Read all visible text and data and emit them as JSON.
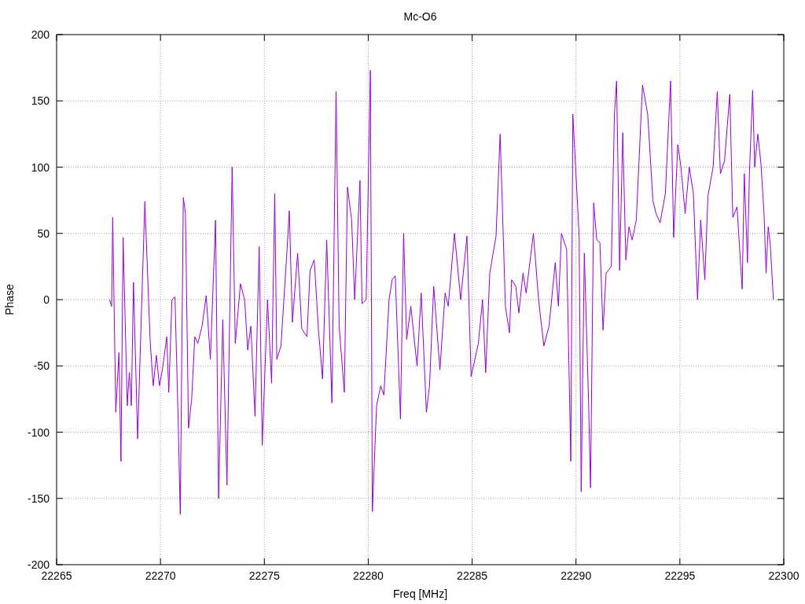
{
  "chart_data": {
    "type": "line",
    "grid": true,
    "title": "Mc-O6",
    "xlabel": "Freq [MHz]",
    "ylabel": "Phase",
    "xlim": [
      22265,
      22300
    ],
    "ylim": [
      -200,
      200
    ],
    "xticks": [
      22265,
      22270,
      22275,
      22280,
      22285,
      22290,
      22295,
      22300
    ],
    "yticks": [
      -200,
      -150,
      -100,
      -50,
      0,
      50,
      100,
      150,
      200
    ],
    "x": [
      22267.55,
      22267.65,
      22267.7,
      22267.85,
      22268.0,
      22268.1,
      22268.2,
      22268.4,
      22268.5,
      22268.6,
      22268.7,
      22268.9,
      22269.1,
      22269.25,
      22269.5,
      22269.65,
      22269.8,
      22269.95,
      22270.1,
      22270.3,
      22270.4,
      22270.55,
      22270.7,
      22270.85,
      22270.95,
      22271.1,
      22271.2,
      22271.35,
      22271.5,
      22271.65,
      22271.8,
      22272.0,
      22272.2,
      22272.4,
      22272.65,
      22272.8,
      22273.0,
      22273.2,
      22273.45,
      22273.6,
      22273.85,
      22274.05,
      22274.2,
      22274.35,
      22274.55,
      22274.75,
      22274.9,
      22275.15,
      22275.35,
      22275.5,
      22275.6,
      22275.8,
      22276.1,
      22276.2,
      22276.35,
      22276.6,
      22276.8,
      22277.05,
      22277.2,
      22277.4,
      22277.6,
      22277.8,
      22278.0,
      22278.25,
      22278.45,
      22278.6,
      22278.85,
      22279.0,
      22279.2,
      22279.35,
      22279.6,
      22279.7,
      22279.9,
      22280.1,
      22280.2,
      22280.4,
      22280.6,
      22280.75,
      22281.0,
      22281.15,
      22281.3,
      22281.55,
      22281.7,
      22281.85,
      22282.05,
      22282.35,
      22282.55,
      22282.8,
      22282.95,
      22283.15,
      22283.45,
      22283.7,
      22283.85,
      22284.15,
      22284.45,
      22284.75,
      22284.95,
      22285.3,
      22285.5,
      22285.65,
      22285.85,
      22286.15,
      22286.35,
      22286.6,
      22286.8,
      22286.9,
      22287.1,
      22287.25,
      22287.45,
      22287.6,
      22287.95,
      22288.2,
      22288.45,
      22288.7,
      22289.0,
      22289.15,
      22289.3,
      22289.55,
      22289.75,
      22289.85,
      22290.15,
      22290.25,
      22290.4,
      22290.6,
      22290.7,
      22290.85,
      22291.0,
      22291.15,
      22291.3,
      22291.45,
      22291.7,
      22291.85,
      22291.95,
      22292.1,
      22292.25,
      22292.4,
      22292.55,
      22292.7,
      22292.9,
      22293.2,
      22293.45,
      22293.7,
      22293.85,
      22294.05,
      22294.3,
      22294.55,
      22294.7,
      22294.9,
      22295.05,
      22295.25,
      22295.45,
      22295.65,
      22295.85,
      22296.0,
      22296.2,
      22296.35,
      22296.6,
      22296.8,
      22296.95,
      22297.15,
      22297.4,
      22297.55,
      22297.75,
      22298.0,
      22298.1,
      22298.25,
      22298.35,
      22298.5,
      22298.6,
      22298.75,
      22298.9,
      22299.05,
      22299.15,
      22299.25,
      22299.35,
      22299.5
    ],
    "series": [
      {
        "color": "#9400d3",
        "values": [
          0,
          -5,
          62,
          -85,
          -40,
          -122,
          47,
          -80,
          -55,
          -80,
          13,
          -105,
          0,
          74,
          -30,
          -65,
          -42,
          -65,
          -52,
          -28,
          -70,
          0,
          2,
          -90,
          -162,
          77,
          65,
          -97,
          -75,
          -28,
          -33,
          -20,
          3,
          -45,
          60,
          -150,
          -15,
          -140,
          100,
          -33,
          12,
          0,
          -38,
          -20,
          -88,
          40,
          -110,
          0,
          -63,
          80,
          -45,
          -35,
          40,
          67,
          -17,
          35,
          -22,
          -28,
          22,
          30,
          -22,
          -60,
          45,
          -78,
          157,
          -20,
          -70,
          85,
          60,
          0,
          90,
          -3,
          0,
          173,
          -160,
          -80,
          -65,
          -72,
          0,
          15,
          18,
          -90,
          50,
          -30,
          -5,
          -50,
          5,
          -85,
          -65,
          10,
          -53,
          5,
          -5,
          50,
          0,
          48,
          -58,
          -33,
          0,
          -55,
          20,
          48,
          125,
          -5,
          -25,
          15,
          10,
          -10,
          20,
          5,
          50,
          0,
          -35,
          -20,
          28,
          -5,
          50,
          38,
          -122,
          140,
          48,
          -145,
          35,
          -75,
          -142,
          73,
          45,
          43,
          -23,
          20,
          25,
          140,
          165,
          22,
          126,
          30,
          55,
          45,
          60,
          162,
          140,
          75,
          65,
          58,
          80,
          165,
          47,
          117,
          100,
          65,
          100,
          80,
          0,
          60,
          15,
          78,
          100,
          157,
          95,
          105,
          155,
          62,
          70,
          8,
          95,
          28,
          97,
          158,
          100,
          125,
          103,
          65,
          20,
          55,
          42,
          0
        ]
      }
    ]
  }
}
